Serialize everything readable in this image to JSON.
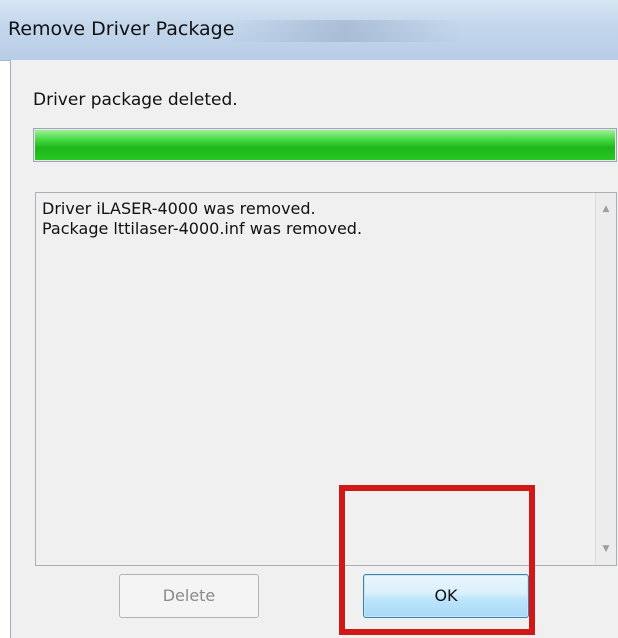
{
  "window": {
    "title": "Remove Driver Package"
  },
  "status": {
    "text": "Driver package deleted.",
    "progress_fraction": 1.0
  },
  "log": {
    "lines": [
      "Driver iLASER-4000 was removed.",
      "Package lttilaser-4000.inf was removed."
    ]
  },
  "buttons": {
    "delete_label": "Delete",
    "ok_label": "OK"
  },
  "icons": {
    "scroll_up": "scroll-up-arrow-icon",
    "scroll_down": "scroll-down-arrow-icon"
  },
  "colors": {
    "progress_green": "#27c823",
    "highlight_red": "#d01818",
    "ok_button_border": "#3c7fb1"
  }
}
